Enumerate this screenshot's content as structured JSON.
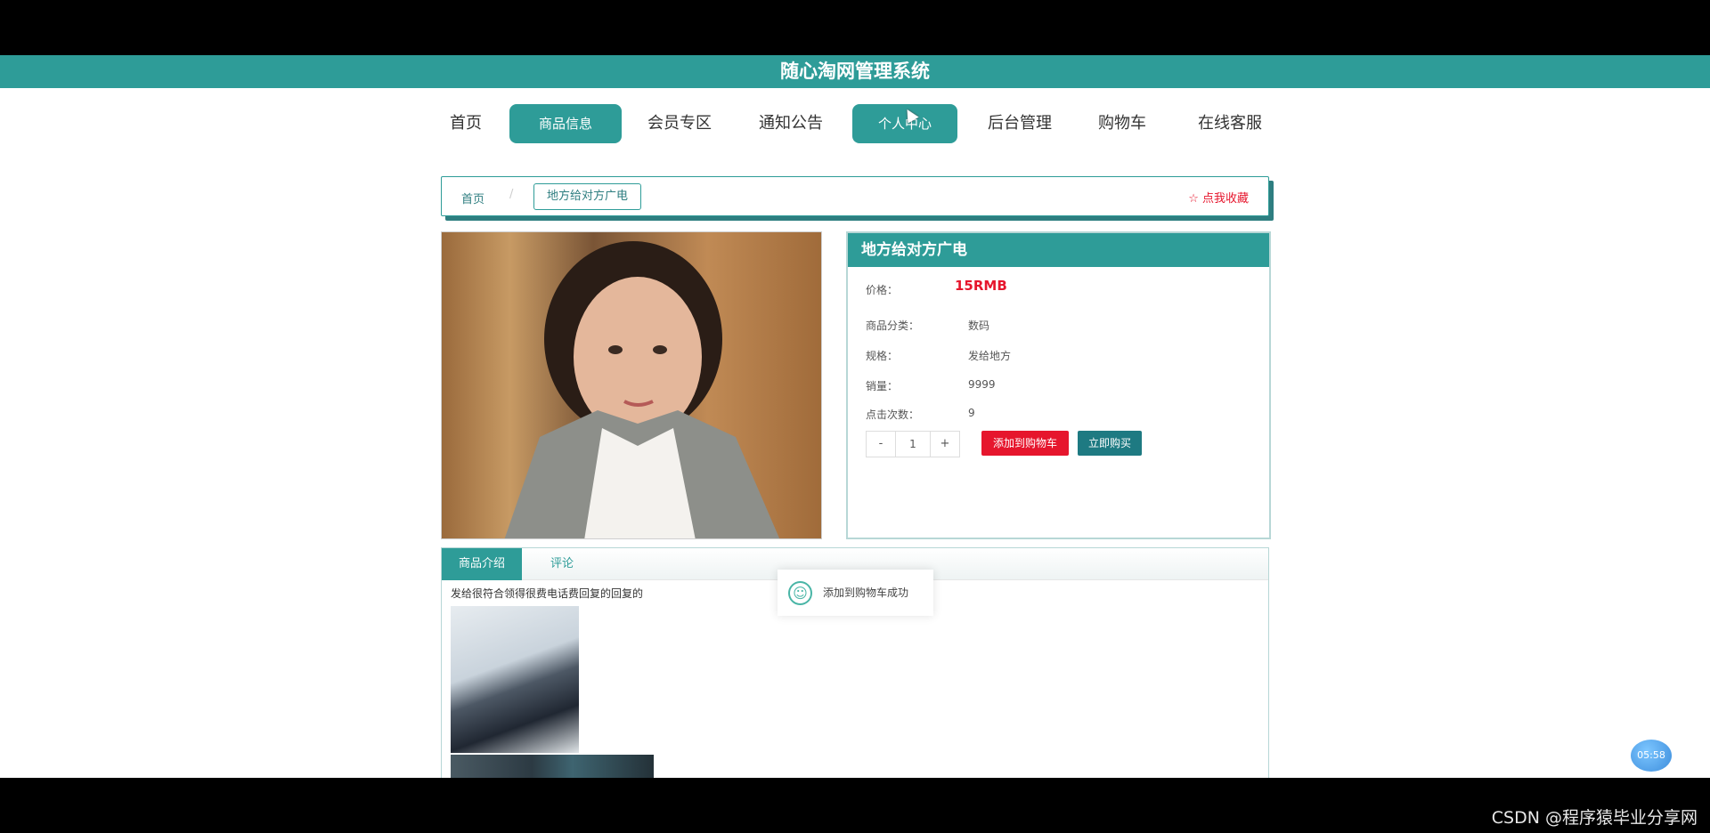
{
  "app": {
    "title": "随心淘网管理系统"
  },
  "nav": {
    "items": [
      {
        "label": "首页"
      },
      {
        "label": "商品信息"
      },
      {
        "label": "会员专区"
      },
      {
        "label": "通知公告"
      },
      {
        "label": "个人中心"
      },
      {
        "label": "后台管理"
      },
      {
        "label": "购物车"
      },
      {
        "label": "在线客服"
      }
    ],
    "active_index": 1
  },
  "breadcrumb": {
    "home": "首页",
    "separator": "/",
    "current": "地方给对方广电",
    "favorite": "点我收藏"
  },
  "product": {
    "name": "地方给对方广电",
    "price_label": "价格：",
    "price": "15RMB",
    "category_label": "商品分类：",
    "category": "数码",
    "spec_label": "规格：",
    "spec": "发给地方",
    "sales_label": "销量：",
    "sales": "9999",
    "clicks_label": "点击次数：",
    "clicks": "9",
    "quantity": "1",
    "minus": "-",
    "plus": "+",
    "add_cart": "添加到购物车",
    "buy_now": "立即购买"
  },
  "tabs": [
    {
      "label": "商品介绍"
    },
    {
      "label": "评论"
    }
  ],
  "description": {
    "text": "发给很符合领得很费电话费回复的回复的"
  },
  "toast": {
    "text": "添加到购物车成功"
  },
  "clock": {
    "time": "05:58"
  },
  "watermark": {
    "text": "CSDN @程序猿毕业分享网"
  },
  "colors": {
    "accent": "#2e9c98",
    "price": "#e6162d",
    "buy": "#1e7a82"
  }
}
